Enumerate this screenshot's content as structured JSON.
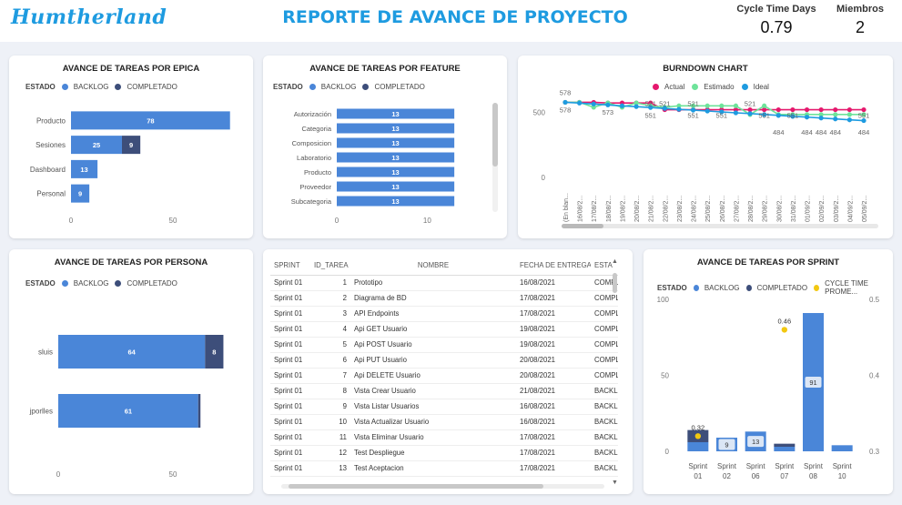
{
  "header": {
    "logo": "Humtherland",
    "title": "REPORTE DE AVANCE DE PROYECTO",
    "kpi_cycle_label": "Cycle Time Days",
    "kpi_cycle_value": "0.79",
    "kpi_members_label": "Miembros",
    "kpi_members_value": "2"
  },
  "colors": {
    "backlog": "#4a86d8",
    "completado": "#3d4e7a",
    "actual": "#e5186d",
    "estimado": "#6ee39a",
    "ideal": "#1e9be0",
    "cycle": "#f2c811"
  },
  "legend": {
    "estado": "ESTADO",
    "backlog": "BACKLOG",
    "completado": "COMPLETADO",
    "cycle": "CYCLE TIME PROME...",
    "actual": "Actual",
    "estimado": "Estimado",
    "ideal": "Ideal"
  },
  "chart_data": [
    {
      "id": "epica",
      "type": "bar",
      "orientation": "horizontal",
      "stacked": true,
      "title": "AVANCE DE TAREAS POR EPICA",
      "categories": [
        "Producto",
        "Sesiones",
        "Dashboard",
        "Personal"
      ],
      "series": [
        {
          "name": "BACKLOG",
          "values": [
            78,
            25,
            13,
            9
          ]
        },
        {
          "name": "COMPLETADO",
          "values": [
            0,
            9,
            0,
            0
          ]
        }
      ],
      "xlim": [
        0,
        100
      ],
      "xticks": [
        "0",
        "50"
      ]
    },
    {
      "id": "feature",
      "type": "bar",
      "orientation": "horizontal",
      "stacked": true,
      "title": "AVANCE DE TAREAS POR FEATURE",
      "categories": [
        "Autorización",
        "Categoria",
        "Composicion",
        "Laboratorio",
        "Producto",
        "Proveedor",
        "Subcategoria"
      ],
      "series": [
        {
          "name": "BACKLOG",
          "values": [
            13,
            13,
            13,
            13,
            13,
            13,
            13
          ]
        },
        {
          "name": "COMPLETADO",
          "values": [
            0,
            0,
            0,
            0,
            0,
            0,
            0
          ]
        }
      ],
      "xlim": [
        0,
        15
      ],
      "xticks": [
        "0",
        "10"
      ]
    },
    {
      "id": "burndown",
      "type": "line",
      "title": "BURNDOWN CHART",
      "x": [
        "(En blan...",
        "16/08/2...",
        "17/08/2...",
        "18/08/2...",
        "19/08/2...",
        "20/08/2...",
        "21/08/2...",
        "22/08/2...",
        "23/08/2...",
        "24/08/2...",
        "25/08/2...",
        "26/08/2...",
        "27/08/2...",
        "28/08/2...",
        "29/08/2...",
        "30/08/2...",
        "31/08/2...",
        "01/09/2...",
        "02/09/2...",
        "03/09/2...",
        "04/09/2...",
        "05/09/2..."
      ],
      "series": [
        {
          "name": "Actual",
          "values": [
            578,
            578,
            578,
            573,
            573,
            573,
            573,
            521,
            521,
            521,
            521,
            521,
            521,
            521,
            521,
            521,
            521,
            521,
            521,
            521,
            521,
            521
          ]
        },
        {
          "name": "Estimado",
          "values": [
            578,
            578,
            540,
            573,
            540,
            573,
            551,
            540,
            551,
            551,
            551,
            551,
            551,
            484,
            551,
            484,
            484,
            484,
            484,
            484,
            484,
            484
          ]
        },
        {
          "name": "Ideal",
          "values": [
            578,
            572,
            565,
            558,
            551,
            545,
            538,
            531,
            524,
            518,
            511,
            504,
            497,
            491,
            484,
            477,
            470,
            464,
            457,
            450,
            443,
            437
          ]
        }
      ],
      "data_labels": [
        {
          "x": "(En blan...",
          "text": "578"
        },
        {
          "x": "(En blan...",
          "text": "578"
        },
        {
          "x": "18/08/2...",
          "text": "573"
        },
        {
          "x": "21/08/2...",
          "text": "521"
        },
        {
          "x": "21/08/2...",
          "text": "551"
        },
        {
          "x": "22/08/2...",
          "text": "521"
        },
        {
          "x": "24/08/2...",
          "text": "521"
        },
        {
          "x": "24/08/2...",
          "text": "551"
        },
        {
          "x": "26/08/2...",
          "text": "551"
        },
        {
          "x": "28/08/2...",
          "text": "521"
        },
        {
          "x": "29/08/2...",
          "text": "551"
        },
        {
          "x": "30/08/2...",
          "text": "484"
        },
        {
          "x": "31/08/2...",
          "text": "551"
        },
        {
          "x": "01/09/2...",
          "text": "484"
        },
        {
          "x": "02/09/2...",
          "text": "484"
        },
        {
          "x": "03/09/2...",
          "text": "484"
        },
        {
          "x": "05/09/2...",
          "text": "551"
        },
        {
          "x": "05/09/2...",
          "text": "484"
        }
      ],
      "ylim": [
        0,
        700
      ],
      "yticks": [
        "0",
        "500"
      ]
    },
    {
      "id": "persona",
      "type": "bar",
      "orientation": "horizontal",
      "stacked": true,
      "title": "AVANCE DE TAREAS POR PERSONA",
      "categories": [
        "sluis",
        "jporlles"
      ],
      "series": [
        {
          "name": "BACKLOG",
          "values": [
            64,
            61
          ]
        },
        {
          "name": "COMPLETADO",
          "values": [
            8,
            1
          ]
        }
      ],
      "xlim": [
        0,
        100
      ],
      "xticks": [
        "0",
        "50"
      ]
    },
    {
      "id": "sprint",
      "type": "bar",
      "stacked": true,
      "title": "AVANCE DE TAREAS POR SPRINT",
      "categories": [
        "Sprint 01",
        "Sprint 02",
        "Sprint 06",
        "Sprint 07",
        "Sprint 08",
        "Sprint 10"
      ],
      "series": [
        {
          "name": "BACKLOG",
          "values": [
            6,
            9,
            13,
            3,
            91,
            4
          ]
        },
        {
          "name": "COMPLETADO",
          "values": [
            8,
            0,
            0,
            2,
            0,
            0
          ]
        },
        {
          "name": "CYCLE TIME PROME...",
          "values": [
            0.32,
            null,
            null,
            0.46,
            null,
            null
          ],
          "axis": "right"
        }
      ],
      "bar_labels": [
        "",
        "9",
        "13",
        "",
        "91",
        ""
      ],
      "point_labels": [
        "0.32",
        "",
        "",
        "0.46",
        "",
        ""
      ],
      "ylim": [
        0,
        100
      ],
      "yticks": [
        "0",
        "50",
        "100"
      ],
      "y2lim": [
        0.3,
        0.5
      ],
      "y2ticks": [
        "0.3",
        "0.4",
        "0.5"
      ]
    }
  ],
  "table": {
    "headers": [
      "SPRINT",
      "ID_TAREA",
      "NOMBRE",
      "FECHA DE ENTREGA",
      "ESTA"
    ],
    "rows": [
      [
        "Sprint 01",
        "1",
        "Prototipo",
        "16/08/2021",
        "COMPLE"
      ],
      [
        "Sprint 01",
        "2",
        "Diagrama de BD",
        "17/08/2021",
        "COMPLE"
      ],
      [
        "Sprint 01",
        "3",
        "API Endpoints",
        "17/08/2021",
        "COMPLE"
      ],
      [
        "Sprint 01",
        "4",
        "Api GET Usuario",
        "19/08/2021",
        "COMPLE"
      ],
      [
        "Sprint 01",
        "5",
        "Api POST Usuario",
        "19/08/2021",
        "COMPLE"
      ],
      [
        "Sprint 01",
        "6",
        "Api PUT Usuario",
        "20/08/2021",
        "COMPLE"
      ],
      [
        "Sprint 01",
        "7",
        "Api DELETE Usuario",
        "20/08/2021",
        "COMPLE"
      ],
      [
        "Sprint 01",
        "8",
        "Vista Crear Usuario",
        "21/08/2021",
        "BACKLO"
      ],
      [
        "Sprint 01",
        "9",
        "Vista Listar Usuarios",
        "16/08/2021",
        "BACKLO"
      ],
      [
        "Sprint 01",
        "10",
        "Vista Actualizar Usuario",
        "16/08/2021",
        "BACKLO"
      ],
      [
        "Sprint 01",
        "11",
        "Vista Eliminar Usuario",
        "17/08/2021",
        "BACKLO"
      ],
      [
        "Sprint 01",
        "12",
        "Test Despliegue",
        "17/08/2021",
        "BACKLO"
      ],
      [
        "Sprint 01",
        "13",
        "Test Aceptacion",
        "17/08/2021",
        "BACKLO"
      ]
    ]
  }
}
